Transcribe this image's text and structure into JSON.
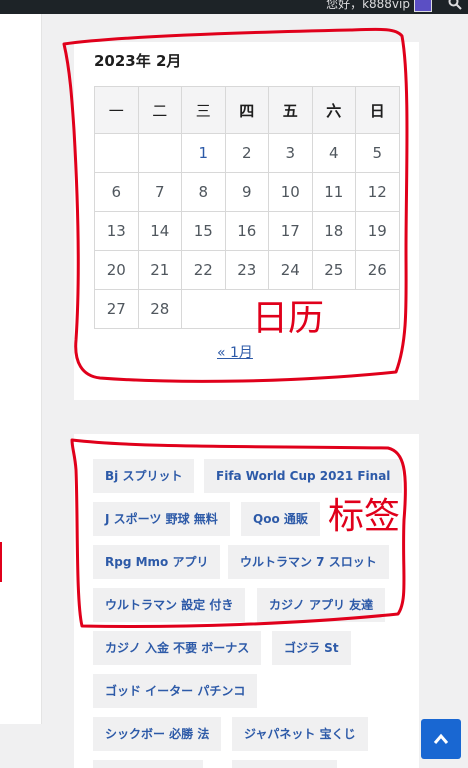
{
  "admin_bar": {
    "greeting": "您好，k888vip"
  },
  "calendar": {
    "caption": "2023年 2月",
    "weekdays": [
      "一",
      "二",
      "三",
      "四",
      "五",
      "六",
      "日"
    ],
    "rows": [
      [
        "",
        "",
        "1",
        "2",
        "3",
        "4",
        "5"
      ],
      [
        "6",
        "7",
        "8",
        "9",
        "10",
        "11",
        "12"
      ],
      [
        "13",
        "14",
        "15",
        "16",
        "17",
        "18",
        "19"
      ],
      [
        "20",
        "21",
        "22",
        "23",
        "24",
        "25",
        "26"
      ],
      [
        "27",
        "28",
        "",
        "",
        "",
        "",
        ""
      ]
    ],
    "prev_link": "« 1月"
  },
  "tags": [
    "Bj スプリット",
    "Fifa World Cup 2021 Final",
    "J スポーツ 野球 無料",
    "Qoo 通販",
    "Rpg Mmo アプリ",
    "ウルトラマン 7 スロット",
    "ウルトラマン 設定 付き",
    "カジノ アプリ 友達",
    "カジノ 入金 不要 ボーナス",
    "ゴジラ St",
    "ゴッド イーター パチンコ",
    "シックボー 必勝 法",
    "ジャパネット 宝くじ"
  ],
  "annotations": {
    "calendar_note": "日历",
    "tags_note": "标签",
    "color": "#e0001b"
  },
  "colors": {
    "link": "#2d5aa8",
    "tag_bg": "#f0f0f1",
    "to_top_bg": "#1967d2"
  }
}
